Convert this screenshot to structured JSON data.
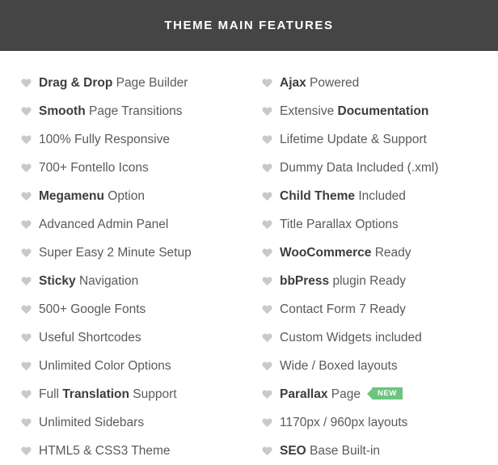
{
  "header": {
    "title": "THEME MAIN FEATURES",
    "background_color": "#454545",
    "text_color": "#ffffff"
  },
  "colors": {
    "bullet": "#c9c9c9",
    "text": "#5a5a5a",
    "text_bold": "#3d3d3d",
    "badge_green": "#6cc47e",
    "page_background": "#ffffff"
  },
  "bullet_icon_name": "heart-icon",
  "columns": {
    "left": [
      {
        "bold": "Drag & Drop",
        "rest": " Page Builder",
        "bold_first": true
      },
      {
        "bold": "Smooth",
        "rest": " Page Transitions",
        "bold_first": true
      },
      {
        "bold": "",
        "rest": "100% Fully Responsive",
        "bold_first": true
      },
      {
        "bold": "",
        "rest": "700+ Fontello Icons",
        "bold_first": true
      },
      {
        "bold": "Megamenu",
        "rest": " Option",
        "bold_first": true
      },
      {
        "bold": "",
        "rest": "Advanced Admin Panel",
        "bold_first": true
      },
      {
        "bold": "",
        "rest": "Super Easy 2 Minute Setup",
        "bold_first": true
      },
      {
        "bold": "Sticky",
        "rest": " Navigation",
        "bold_first": true
      },
      {
        "bold": "",
        "rest": "500+ Google Fonts",
        "bold_first": true
      },
      {
        "bold": "",
        "rest": "Useful Shortcodes",
        "bold_first": true
      },
      {
        "bold": "",
        "rest": "Unlimited Color Options",
        "bold_first": true
      },
      {
        "pre": "Full ",
        "bold": "Translation",
        "rest": " Support",
        "bold_first": false
      },
      {
        "bold": "",
        "rest": "Unlimited Sidebars",
        "bold_first": true
      },
      {
        "bold": "",
        "rest": "HTML5 & CSS3 Theme",
        "bold_first": true
      }
    ],
    "right": [
      {
        "bold": "Ajax",
        "rest": " Powered",
        "bold_first": true
      },
      {
        "pre": "Extensive ",
        "bold": "Documentation",
        "rest": "",
        "bold_first": false
      },
      {
        "bold": "",
        "rest": "Lifetime Update & Support",
        "bold_first": true
      },
      {
        "bold": "",
        "rest": "Dummy Data Included (.xml)",
        "bold_first": true
      },
      {
        "bold": "Child Theme",
        "rest": " Included",
        "bold_first": true
      },
      {
        "bold": "",
        "rest": "Title Parallax Options",
        "bold_first": true
      },
      {
        "bold": "WooCommerce",
        "rest": " Ready",
        "bold_first": true
      },
      {
        "bold": "bbPress",
        "rest": " plugin Ready",
        "bold_first": true
      },
      {
        "bold": "",
        "rest": "Contact Form 7 Ready",
        "bold_first": true
      },
      {
        "bold": "",
        "rest": "Custom Widgets included",
        "bold_first": true
      },
      {
        "bold": "",
        "rest": "Wide / Boxed layouts",
        "bold_first": true
      },
      {
        "bold": "Parallax",
        "rest": " Page",
        "bold_first": true,
        "badge": "NEW"
      },
      {
        "bold": "",
        "rest": "1170px / 960px layouts",
        "bold_first": true
      },
      {
        "bold": "SEO",
        "rest": " Base Built-in",
        "bold_first": true
      }
    ]
  }
}
